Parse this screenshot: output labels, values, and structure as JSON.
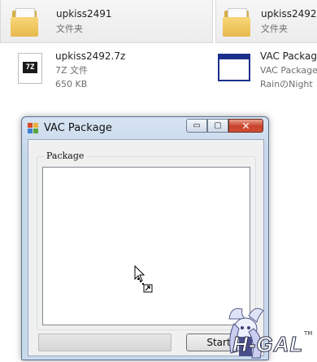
{
  "files": [
    {
      "name": "upkiss2491",
      "type_label": "文件夹",
      "icon": "folder-icon"
    },
    {
      "name": "upkiss2492",
      "type_label": "文件夹",
      "icon": "folder-icon"
    },
    {
      "name": "upkiss2492.7z",
      "type_label": "7Z 文件",
      "size": "650 KB",
      "icon": "7z-archive-icon",
      "icon_text": "7Z"
    },
    {
      "name": "VAC Package",
      "description": "VAC Package",
      "company": "RainのNight",
      "icon": "application-icon"
    }
  ],
  "dialog": {
    "title": "VAC Package",
    "group_label": "Package",
    "start_button": "Start",
    "progress": 0
  },
  "caption_glyphs": {
    "minimize": "▭",
    "maximize": "▢",
    "close": "✕"
  },
  "watermark": {
    "text": "H-GAL",
    "tm": "TM"
  },
  "colors": {
    "titlebar": "#c9d9ec",
    "close_button": "#c7412b",
    "folder": "#e8b94d"
  }
}
